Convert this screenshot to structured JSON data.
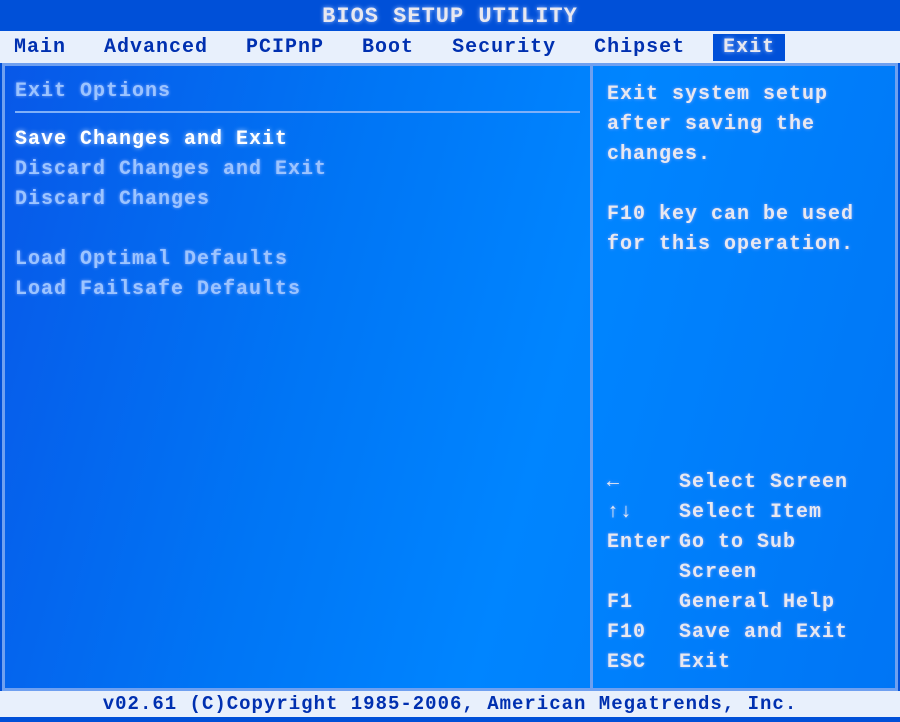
{
  "title": "BIOS SETUP UTILITY",
  "tabs": {
    "main": "Main",
    "advanced": "Advanced",
    "pcipnp": "PCIPnP",
    "boot": "Boot",
    "security": "Security",
    "chipset": "Chipset",
    "exit": "Exit"
  },
  "active_tab": "exit",
  "section_header": "Exit Options",
  "menu": {
    "save_exit": "Save Changes and Exit",
    "discard_exit": "Discard Changes and Exit",
    "discard": "Discard Changes",
    "load_optimal": "Load Optimal Defaults",
    "load_failsafe": "Load Failsafe Defaults"
  },
  "selected_menu": "save_exit",
  "help": {
    "line1": "Exit system setup",
    "line2": "after saving the",
    "line3": "changes.",
    "line4": "F10 key can be used",
    "line5": "for this operation."
  },
  "keys": {
    "lr": {
      "k": "←",
      "d": "Select Screen"
    },
    "ud": {
      "k": "↑↓",
      "d": "Select Item"
    },
    "enter": {
      "k": "Enter",
      "d": "Go to Sub Screen"
    },
    "f1": {
      "k": "F1",
      "d": "General Help"
    },
    "f10": {
      "k": "F10",
      "d": "Save and Exit"
    },
    "esc": {
      "k": "ESC",
      "d": "Exit"
    }
  },
  "footer": "v02.61 (C)Copyright 1985-2006, American Megatrends, Inc."
}
